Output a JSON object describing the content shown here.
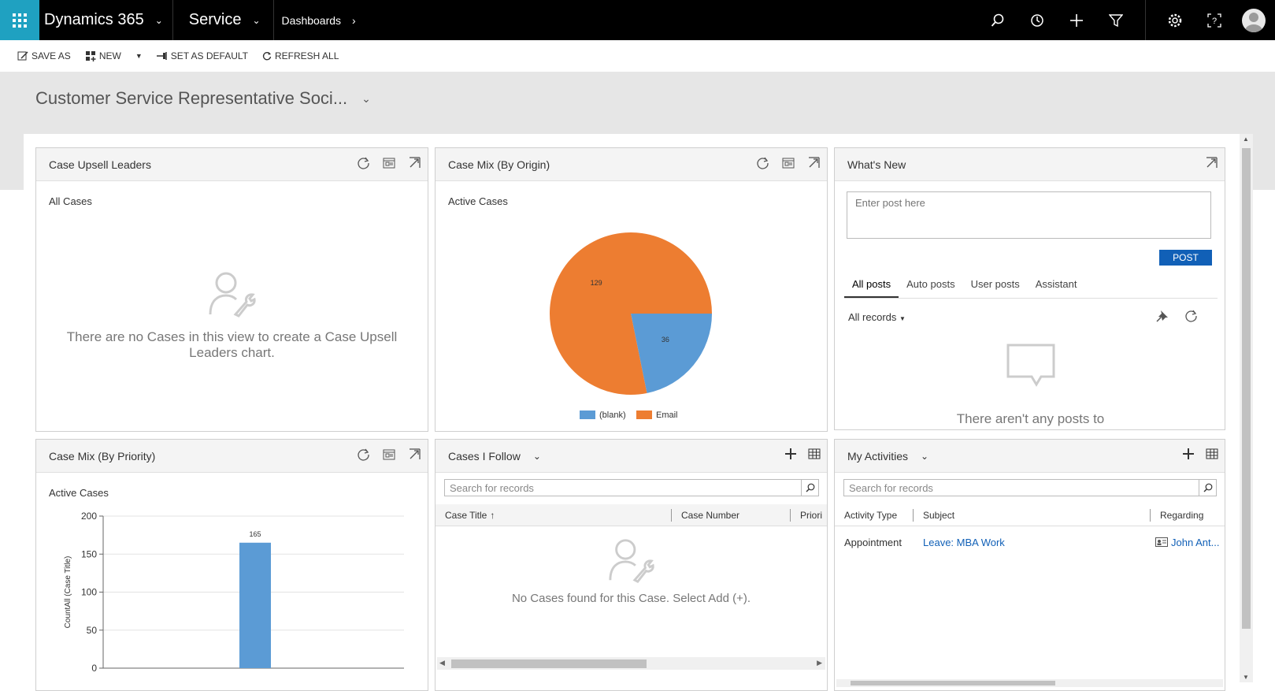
{
  "app": {
    "title": "Dynamics 365",
    "area": "Service",
    "breadcrumb": "Dashboards"
  },
  "commands": {
    "save_as": "SAVE AS",
    "new": "NEW",
    "set_default": "SET AS DEFAULT",
    "refresh_all": "REFRESH ALL"
  },
  "dashboard": {
    "title": "Customer Service Representative Soci..."
  },
  "upsell": {
    "title": "Case Upsell Leaders",
    "view": "All Cases",
    "empty": "There are no Cases in this view to create a Case Upsell Leaders chart."
  },
  "origin": {
    "title": "Case Mix (By Origin)",
    "view": "Active Cases",
    "chart_data": {
      "type": "pie",
      "categories": [
        "(blank)",
        "Email"
      ],
      "values": [
        36,
        129
      ],
      "colors": [
        "#5b9bd5",
        "#ed7d31"
      ],
      "legend": "bottom"
    }
  },
  "whatsnew": {
    "title": "What's New",
    "placeholder": "Enter post here",
    "post": "POST",
    "tabs": [
      "All posts",
      "Auto posts",
      "User posts",
      "Assistant"
    ],
    "filter": "All records",
    "empty": "There aren't any posts to"
  },
  "priority": {
    "title": "Case Mix (By Priority)",
    "view": "Active Cases",
    "chart_data": {
      "type": "bar",
      "ylabel": "CountAll (Case Title)",
      "yticks": [
        0,
        50,
        100,
        150,
        200
      ],
      "ylim": [
        0,
        200
      ],
      "values": [
        165
      ],
      "color": "#5b9bd5",
      "grid": true
    }
  },
  "follow": {
    "title": "Cases I Follow",
    "search": "Search for records",
    "columns": [
      "Case Title",
      "Case Number",
      "Priori"
    ],
    "empty": "No Cases found for this Case. Select Add (+)."
  },
  "activities": {
    "title": "My Activities",
    "search": "Search for records",
    "columns": [
      "Activity Type",
      "Subject",
      "Regarding"
    ],
    "rows": [
      {
        "type": "Appointment",
        "subject": "Leave: MBA Work",
        "regarding": "John Ant..."
      }
    ]
  }
}
